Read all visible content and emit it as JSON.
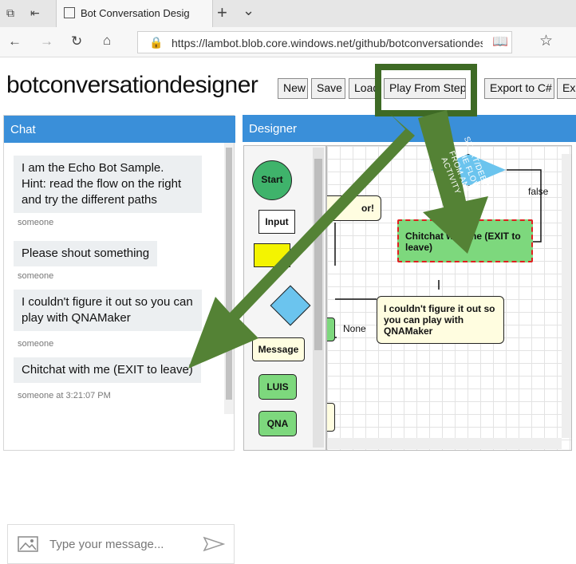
{
  "browser": {
    "tab_title": "Bot Conversation Desig",
    "address": "https://lambot.blob.core.windows.net/github/botconversationdesigner/in",
    "new_tab_glyph": "+",
    "tabs_menu_glyph": "⌄"
  },
  "app": {
    "brand": "botconversationdesigner",
    "toolbar": {
      "new_label": "New",
      "save_label": "Save",
      "load_label": "Load",
      "play_from_step_label": "Play From Step",
      "export_csharp_label": "Export to C#",
      "export_cut_label": "Exp"
    }
  },
  "chat": {
    "title": "Chat",
    "messages": [
      {
        "text": "I am the Echo Bot Sample.\nHint: read the flow on the right and try the different paths",
        "meta": "someone"
      },
      {
        "text": "Please shout something",
        "meta": "someone"
      },
      {
        "text": "I couldn't figure it out so you can play with QNAMaker",
        "meta": "someone"
      },
      {
        "text": "Chitchat with me (EXIT to leave)",
        "meta": "someone at 3:21:07 PM"
      }
    ],
    "input_placeholder": "Type your message..."
  },
  "designer": {
    "title": "Designer",
    "palette": [
      "Start",
      "Input",
      "Message",
      "LUIS",
      "QNA"
    ],
    "nodes": {
      "chitchat": "Chitchat with me (EXIT to leave)",
      "qna": "I couldn't figure it out so you can play with QNAMaker",
      "error": "or!"
    },
    "edge_labels": {
      "false": "false",
      "none": "None"
    }
  },
  "annotation": {
    "text": "START/DEBUG THE FLOW FROM ANY ACTIVITY",
    "color": "#548235",
    "highlight_border": "#3e6a25"
  },
  "colors": {
    "accent": "#3a8fd9",
    "chat_bubble": "#eceff1",
    "node_green": "#7dd87d",
    "node_yellow": "#fffde0",
    "selection": "#e02020"
  }
}
